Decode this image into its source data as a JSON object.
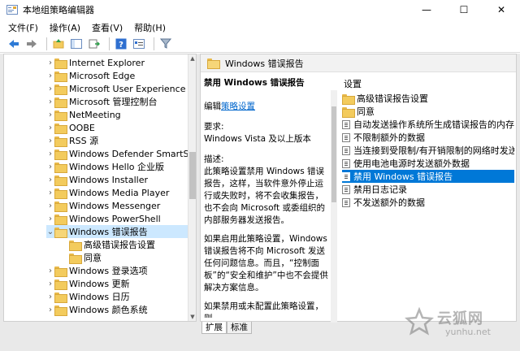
{
  "window": {
    "title": "本地组策略编辑器",
    "minimize": "—",
    "maximize": "☐",
    "close": "✕"
  },
  "menu": [
    "文件(F)",
    "操作(A)",
    "查看(V)",
    "帮助(H)"
  ],
  "toolbar": {
    "icons": [
      "back-arrow-icon",
      "forward-arrow-icon",
      "up-folder-icon",
      "show-hide-tree-icon",
      "export-list-icon",
      "help-icon",
      "properties-icon",
      "filter-icon"
    ]
  },
  "tree": {
    "items": [
      {
        "label": "Internet Explorer",
        "expandable": true
      },
      {
        "label": "Microsoft Edge",
        "expandable": true
      },
      {
        "label": "Microsoft User Experience Vir",
        "expandable": true
      },
      {
        "label": "Microsoft 管理控制台",
        "expandable": true
      },
      {
        "label": "NetMeeting",
        "expandable": true
      },
      {
        "label": "OOBE",
        "expandable": true
      },
      {
        "label": "RSS 源",
        "expandable": true
      },
      {
        "label": "Windows Defender SmartScre",
        "expandable": true
      },
      {
        "label": "Windows Hello 企业版",
        "expandable": true
      },
      {
        "label": "Windows Installer",
        "expandable": true
      },
      {
        "label": "Windows Media Player",
        "expandable": true
      },
      {
        "label": "Windows Messenger",
        "expandable": true
      },
      {
        "label": "Windows PowerShell",
        "expandable": true
      },
      {
        "label": "Windows 错误报告",
        "expandable": true,
        "expanded": true,
        "selected": true
      },
      {
        "label": "高级错误报告设置",
        "child": true
      },
      {
        "label": "同意",
        "child": true
      },
      {
        "label": "Windows 登录选项",
        "expandable": true
      },
      {
        "label": "Windows 更新",
        "expandable": true
      },
      {
        "label": "Windows 日历",
        "expandable": true
      },
      {
        "label": "Windows 颜色系统",
        "expandable": true
      }
    ]
  },
  "right_header": "Windows 错误报告",
  "description": {
    "policy_title": "禁用 Windows 错误报告",
    "edit_prefix": "编辑",
    "edit_link": "策略设置",
    "requirement_label": "要求:",
    "requirement_value": "Windows Vista 及以上版本",
    "desc_label": "描述:",
    "desc_text": "此策略设置禁用 Windows 错误报告，这样，当软件意外停止运行或失败时，将不会收集报告，也不会向 Microsoft 或委组织的内部服务器发送报告。",
    "para2": "如果启用此策略设置，Windows 错误报告将不向 Microsoft 发送任何问题信息。而且，“控制面板”的“安全和维护”中也不会提供解决方案信息。",
    "para3": "如果禁用或未配置此策略设置，则"
  },
  "settings": {
    "column_header": "设置",
    "items": [
      {
        "label": "高级错误报告设置",
        "type": "folder"
      },
      {
        "label": "同意",
        "type": "folder"
      },
      {
        "label": "自动发送操作系统所生成错误报告的内存转储",
        "type": "setting"
      },
      {
        "label": "不限制额外的数据",
        "type": "setting"
      },
      {
        "label": "当连接到受限制/有开销限制的网络时发送数据",
        "type": "setting"
      },
      {
        "label": "使用电池电源时发送额外数据",
        "type": "setting"
      },
      {
        "label": "禁用 Windows 错误报告",
        "type": "setting",
        "selected": true
      },
      {
        "label": "禁用日志记录",
        "type": "setting"
      },
      {
        "label": "不发送额外的数据",
        "type": "setting"
      }
    ]
  },
  "tabs": [
    "扩展",
    "标准"
  ],
  "watermark": {
    "text": "云狐网",
    "url": "yunhu.net"
  },
  "colors": {
    "selection_blue": "#0078d7",
    "tree_selection": "#cce8ff",
    "link": "#0066cc"
  }
}
